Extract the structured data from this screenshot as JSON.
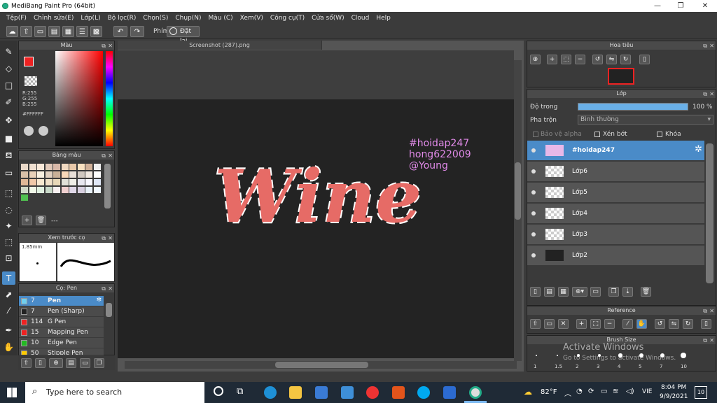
{
  "window": {
    "title": "MediBang Paint Pro (64bit)",
    "minimize": "—",
    "maximize": "❐",
    "close": "✕"
  },
  "menu": [
    "Tệp(F)",
    "Chỉnh sửa(E)",
    "Lớp(L)",
    "Bộ lọc(R)",
    "Chọn(S)",
    "Chụp(N)",
    "Màu (C)",
    "Xem(V)",
    "Công cụ(T)",
    "Cửa sổ(W)",
    "Cloud",
    "Help"
  ],
  "toolbar": {
    "keys_label": "Phím",
    "reset_label": "Đặt lại"
  },
  "color_panel": {
    "title": "Màu",
    "r": "R:255",
    "g": "G:255",
    "b": "B:255",
    "hex": "#FFFFFF"
  },
  "palette_panel": {
    "title": "Bảng màu",
    "footer": "---"
  },
  "brush_preview": {
    "title": "Xem trước cọ",
    "size": "1.85mm"
  },
  "brush_panel": {
    "title": "Cọ: Pen",
    "items": [
      {
        "size": "7",
        "name": "Pen",
        "color": "#6fd0f0"
      },
      {
        "size": "7",
        "name": "Pen (Sharp)",
        "color": "#222222"
      },
      {
        "size": "114",
        "name": "G Pen",
        "color": "#e22"
      },
      {
        "size": "15",
        "name": "Mapping Pen",
        "color": "#e22"
      },
      {
        "size": "10",
        "name": "Edge Pen",
        "color": "#2b2"
      },
      {
        "size": "50",
        "name": "Stipple Pen",
        "color": "#fc0"
      }
    ]
  },
  "canvas": {
    "tab": "Screenshot (287).png",
    "art_text": "Wine",
    "credits": [
      "#hoidap247",
      "hong622009",
      "@Young"
    ]
  },
  "navigator": {
    "title": "Hoa tiêu"
  },
  "layer_panel": {
    "title": "Lớp",
    "opacity_label": "Độ trong",
    "opacity_value": "100 %",
    "opacity": 1.0,
    "blend_label": "Pha trộn",
    "blend_value": "Bình thường",
    "protect_alpha": "Bảo vệ alpha",
    "clipping": "Xén bớt",
    "lock": "Khóa",
    "layers": [
      "#hoidap247",
      "Lớp6",
      "Lớp5",
      "Lớp4",
      "Lớp3",
      "Lớp2"
    ]
  },
  "reference_panel": {
    "title": "Reference"
  },
  "brush_size_panel": {
    "title": "Brush Size",
    "sizes": [
      "1",
      "1.5",
      "2",
      "3",
      "4",
      "5",
      "7",
      "10"
    ]
  },
  "watermark": {
    "line1": "Activate Windows",
    "line2": "Go to Settings to activate Windows."
  },
  "taskbar": {
    "search_placeholder": "Type here to search",
    "temperature": "82°F",
    "lang": "VIE",
    "time": "8:04 PM",
    "date": "9/9/2021",
    "notif": "10"
  }
}
